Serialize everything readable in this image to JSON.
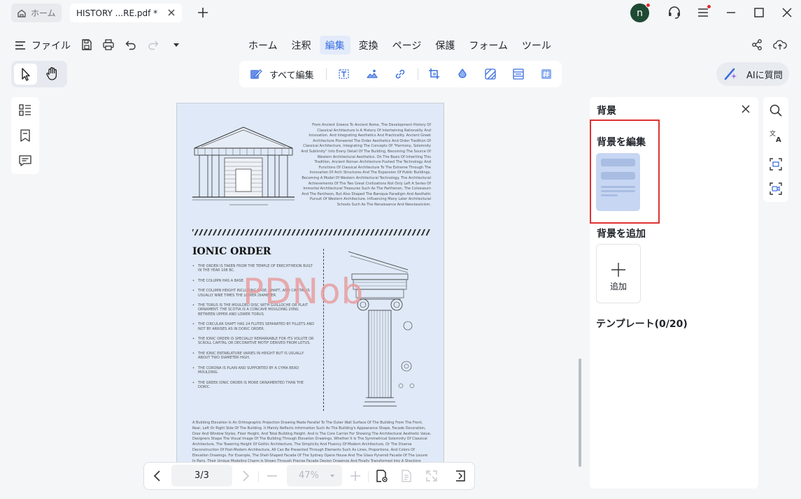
{
  "tabs": {
    "home_label": "ホーム",
    "doc_label": "HISTORY ...RE.pdf *"
  },
  "user": {
    "avatar_letter": "n"
  },
  "toolbar": {
    "file_label": "ファイル"
  },
  "menu": {
    "items": [
      "ホーム",
      "注釈",
      "編集",
      "変換",
      "ページ",
      "保護",
      "フォーム",
      "ツール"
    ],
    "active": "編集"
  },
  "edit_toolbar": {
    "edit_all_label": "すべて編集"
  },
  "ai": {
    "label": "AIに質問"
  },
  "navigation": {
    "page_display": "3/3",
    "zoom_value": "47%"
  },
  "document": {
    "heading": "IONIC ORDER",
    "watermark": "PDNob",
    "right_paragraph": "From Ancient Greece To Ancient Rome, The Development History Of Classical Architecture Is A History Of Intertwining Rationality And Innovation. And Integrating Aesthetics And Practicality. Ancient Greek Architecture Pioneered The Order Aesthetics And Order Tradition Of Classical Architecture, Integrating The Concepts Of \"Harmony, Solemnity And Sublimity\" Into Every Detail Of The Building, Becoming The Source Of Western Architectural Aesthetics. On The Basis Of Inheriting This Tradition, Ancient Roman Architecture Pushed The Technology And Functions Of Classical Architecture To The Extreme Through The Innovation Of Arch Structures And The Expansion Of Public Buildings, Becoming A Model Of Western Architectural Technology. The Architectural Achievements Of The Two Great Civilizations Not Only Left A Series Of Immortal Architectural Treasures Such As The Parthenon, The Colosseum And The Pantheon, But Also Shaped The Baroque Paradigm And Aesthetic Pursuit Of Western Architecture, Influencing Many Later Architectural Schools Such As The Renaissance And Neoclassicism.",
    "bullets": [
      "THE ORDER IS TAKEN FROM THE TEMPLE OF ERECHTHEION BUILT IN THE YEAR 108 BC.",
      "THE COLUMN HAS A BASE.",
      "THE COLUMN HEIGHT INCLUDING BASE, SHAFT, AND CAPITAL IS USUALLY NINE TIMES THE LOWER DIAMETER.",
      "THE TORUS IS THE MOULDED DISC WITH GUILLOCHE OR PLAIT ORNAMENT. THE SCOTIA IS A CONCAVE MOULDING LYING BETWEEN UPPER AND LOWER TORUS.",
      "THE CIRCULAR SHAFT HAS 24 FLUTES SEPARATED BY FILLETS AND NOT BY ARRISES AS IN DORIC ORDER.",
      "THE IONIC ORDER IS SPECIALLY REMARKABLE FOR ITS VOLUTE OR SCROLL CAPITAL OR DECORATIVE MOTIF DERIVED FROM LOTUS.",
      "THE IONIC ENTABLATURE VARIES IN HEIGHT BUT IS USUALLY ABOUT TWO DIAMETER HIGH.",
      "THE CORONA IS PLAIN AND SUPPORTED BY A CYMA BEAD MOULDING.",
      "THE GREEK IONIC ORDER IS MORE ORNAMENTED THAN THE DORIC."
    ],
    "bottom_paragraph": "A Building Elevation Is An Orthographic Projection Drawing Made Parallel To The Outer Wall Surface Of The Building From The Front, Rear, Left Or Right Side Of The Building. It Mainly Reflects Information Such As The Building's Appearance Shape, Facade Decoration, Door And Window Styles, Floor Height, And Total Building Height. And Is The Core Carrier For Showing The Architectural Aesthetic Value. Designers Shape The Visual Image Of The Building Through Elevation Drawings. Whether It Is The Symmetrical Solemnity Of Classical Architecture, The Towering Height Of Gothic Architecture, The Simplicity And Fluency Of Modern Architecture, Or The Diverse Deconstruction Of Post-Modern Architecture, All Can Be Presented Through Elements Such As Lines, Proportions, And Colors Of Elevation Drawings. For Example, The Shell-Shaped Facade Of The Sydney Opera House And The Glass Pyramid Facade Of The Louvre In Paris. Their Unique Modeling Charm Is Shown Through Precise Facade Design Drawings And Finally Transformed Into A Shocking Architectural Entity."
  },
  "right_panel": {
    "title": "背景",
    "edit_label": "背景を編集",
    "add_label": "背景を追加",
    "add_button_label": "追加",
    "template_label": "テンプレート(0/20)"
  },
  "colors": {
    "accent": "#3c6fe0",
    "highlight_border": "#e03131",
    "avatar_bg": "#1f4a33",
    "page_bg": "#dfe9f7",
    "watermark": "#e89a9a"
  }
}
